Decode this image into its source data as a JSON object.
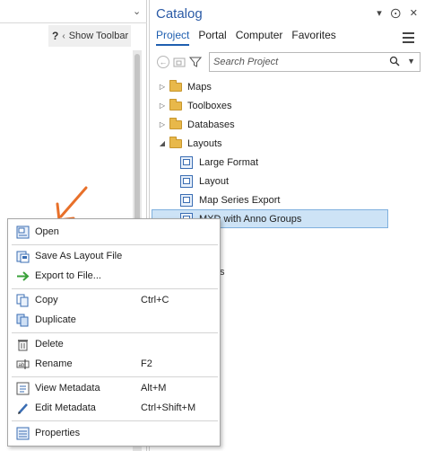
{
  "left_pane": {
    "help_icon": "?",
    "show_toolbar_label": "Show Toolbar"
  },
  "catalog": {
    "title": "Catalog",
    "tabs": [
      {
        "label": "Project",
        "active": true
      },
      {
        "label": "Portal",
        "active": false
      },
      {
        "label": "Computer",
        "active": false
      },
      {
        "label": "Favorites",
        "active": false
      }
    ],
    "search_placeholder": "Search Project",
    "tree": [
      {
        "label": "Maps",
        "type": "folder",
        "expanded": false
      },
      {
        "label": "Toolboxes",
        "type": "folder",
        "expanded": false
      },
      {
        "label": "Databases",
        "type": "folder",
        "expanded": false
      },
      {
        "label": "Layouts",
        "type": "folder",
        "expanded": true
      },
      {
        "label": "Large Format",
        "type": "layout"
      },
      {
        "label": "Layout",
        "type": "layout"
      },
      {
        "label": "Map Series Export",
        "type": "layout"
      },
      {
        "label": "MXD with Anno Groups",
        "type": "layout",
        "selected": true
      }
    ],
    "partial_text": "s"
  },
  "context_menu": {
    "items": [
      {
        "label": "Open",
        "shortcut": "",
        "icon": "open-layout-icon"
      },
      {
        "label": "Save As Layout File",
        "shortcut": "",
        "icon": "save-as-icon"
      },
      {
        "label": "Export to File...",
        "shortcut": "",
        "icon": "export-arrow-icon"
      },
      {
        "label": "Copy",
        "shortcut": "Ctrl+C",
        "icon": "copy-icon"
      },
      {
        "label": "Duplicate",
        "shortcut": "",
        "icon": "duplicate-icon"
      },
      {
        "label": "Delete",
        "shortcut": "",
        "icon": "delete-icon"
      },
      {
        "label": "Rename",
        "shortcut": "F2",
        "icon": "rename-icon"
      },
      {
        "label": "View Metadata",
        "shortcut": "Alt+M",
        "icon": "view-metadata-icon"
      },
      {
        "label": "Edit Metadata",
        "shortcut": "Ctrl+Shift+M",
        "icon": "edit-metadata-icon"
      },
      {
        "label": "Properties",
        "shortcut": "",
        "icon": "properties-icon"
      }
    ]
  },
  "colors": {
    "accent": "#1f5fb0",
    "selection": "#cde3f6",
    "annotation_arrow": "#e8702a",
    "folder": "#e8b84a"
  }
}
